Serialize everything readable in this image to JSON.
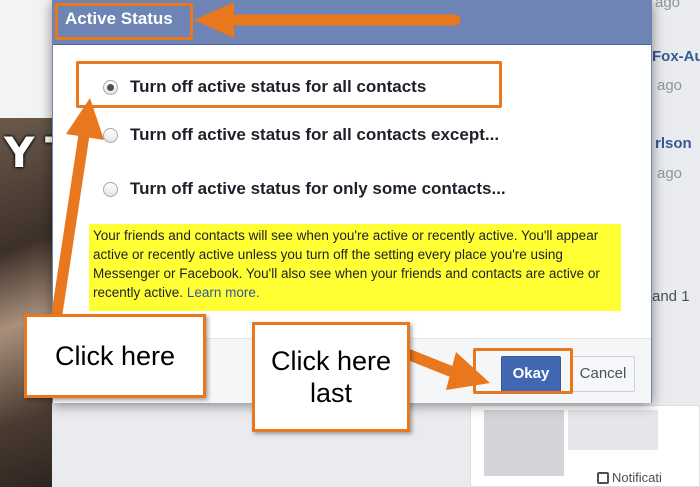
{
  "background": {
    "right_texts": [
      "ago",
      "Fox-Au",
      "ago",
      "rlson",
      "ago",
      "and 1",
      "Notificati"
    ],
    "left_photo_text": "Y T"
  },
  "dialog": {
    "title": "Active Status",
    "options": [
      {
        "label": "Turn off active status for all contacts",
        "selected": true
      },
      {
        "label": "Turn off active status for all contacts except...",
        "selected": false
      },
      {
        "label": "Turn off active status for only some contacts...",
        "selected": false
      }
    ],
    "info_text": "Your friends and contacts will see when you're active or recently active. You'll appear active or recently active unless you turn off the setting every place you're using Messenger or Facebook. You'll also see when your friends and contacts are active or recently active.",
    "learn_more": "Learn more.",
    "okay_label": "Okay",
    "cancel_label": "Cancel"
  },
  "annotations": {
    "callout_1": "Click here",
    "callout_2_line1": "Click here",
    "callout_2_line2": "last",
    "accent_color": "#e8771e",
    "highlight_color": "#ffff33"
  }
}
